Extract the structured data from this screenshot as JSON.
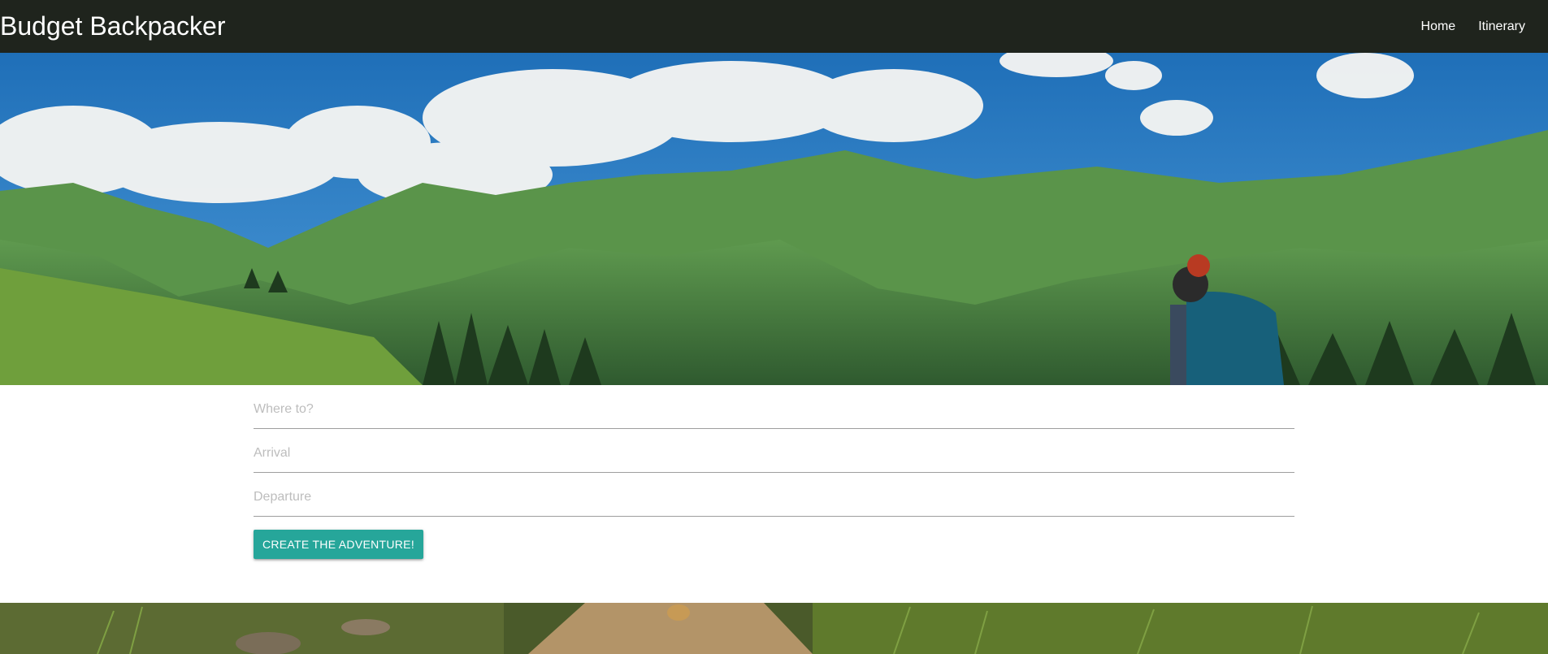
{
  "navbar": {
    "brand": "Budget Backpacker",
    "links": [
      {
        "label": "Home"
      },
      {
        "label": "Itinerary"
      }
    ],
    "background_color": "#1f241d"
  },
  "hero": {
    "image": "mountain-landscape-with-backpacker",
    "sky_color": "#2f7fc4",
    "mountain_color": "#4e8f43"
  },
  "form": {
    "destination_placeholder": "Where to?",
    "arrival_placeholder": "Arrival",
    "departure_placeholder": "Departure",
    "submit_label": "CREATE THE ADVENTURE!",
    "accent_color": "#26a69a"
  },
  "footer": {
    "image": "forest-trail-ground"
  }
}
